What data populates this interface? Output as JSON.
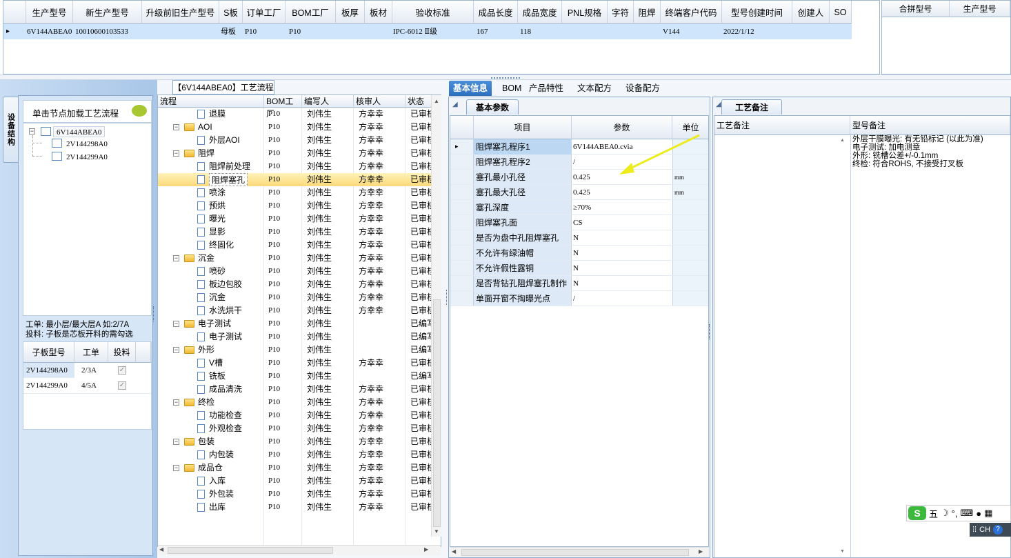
{
  "top_grid": {
    "headers": [
      "生产型号",
      "新生产型号",
      "升级前旧生产型号",
      "S板",
      "订单工厂",
      "BOM工厂",
      "板厚",
      "板材",
      "验收标准",
      "成品长度",
      "成品宽度",
      "PNL规格",
      "字符",
      "阻焊",
      "终端客户代码",
      "型号创建时间",
      "创建人",
      "SO"
    ],
    "row": {
      "marker": "▸",
      "生产型号": "6V144ABEA0",
      "新生产型号": "10010600103533",
      "升级前旧生产型号": "",
      "S板": "母板",
      "订单工厂": "P10",
      "BOM工厂": "P10",
      "板厚": "",
      "板材": "",
      "验收标准": "IPC-6012 Ⅱ级",
      "成品长度": "167",
      "成品宽度": "118",
      "PNL规格": "",
      "字符": "",
      "阻焊": "",
      "终端客户代码": "V144",
      "型号创建时间": "2022/1/12",
      "创建人": "",
      "SO": ""
    }
  },
  "merge_grid": {
    "headers": [
      "合拼型号",
      "生产型号"
    ]
  },
  "left_panel": {
    "vertical_tab": "设备结构",
    "load_hint": "单击节点加载工艺流程",
    "tree": {
      "root": "6V144ABEA0",
      "children": [
        "2V144298A0",
        "2V144299A0"
      ]
    },
    "work_order_note_line1": "工单: 最小层/最大层A 如:2/7A",
    "work_order_note_line2": "投料: 子板是芯板开料的需勾选",
    "sub_grid": {
      "headers": [
        "子板型号",
        "工单",
        "投料"
      ],
      "rows": [
        {
          "model": "2V144298A0",
          "order": "2/3A",
          "feed": true
        },
        {
          "model": "2V144299A0",
          "order": "4/5A",
          "feed": true
        }
      ]
    }
  },
  "process": {
    "title": "【6V144ABEA0】工艺流程",
    "headers": [
      "流程",
      "BOM工厂",
      "编写人",
      "核审人",
      "状态"
    ],
    "rows": [
      {
        "name": "退膜",
        "level": 2,
        "type": "file",
        "factory": "P10",
        "writer": "刘伟生",
        "reviewer": "方幸幸",
        "status": "已审核"
      },
      {
        "name": "AOI",
        "level": 1,
        "type": "folder",
        "factory": "P10",
        "writer": "刘伟生",
        "reviewer": "方幸幸",
        "status": "已审核"
      },
      {
        "name": "外层AOI",
        "level": 2,
        "type": "file",
        "factory": "P10",
        "writer": "刘伟生",
        "reviewer": "方幸幸",
        "status": "已审核"
      },
      {
        "name": "阻焊",
        "level": 1,
        "type": "folder",
        "factory": "P10",
        "writer": "刘伟生",
        "reviewer": "方幸幸",
        "status": "已审核"
      },
      {
        "name": "阻焊前处理",
        "level": 2,
        "type": "file",
        "factory": "P10",
        "writer": "刘伟生",
        "reviewer": "方幸幸",
        "status": "已审核"
      },
      {
        "name": "阻焊塞孔",
        "level": 2,
        "type": "file",
        "factory": "P10",
        "writer": "刘伟生",
        "reviewer": "方幸幸",
        "status": "已审核",
        "selected": true
      },
      {
        "name": "喷涂",
        "level": 2,
        "type": "file",
        "factory": "P10",
        "writer": "刘伟生",
        "reviewer": "方幸幸",
        "status": "已审核"
      },
      {
        "name": "预烘",
        "level": 2,
        "type": "file",
        "factory": "P10",
        "writer": "刘伟生",
        "reviewer": "方幸幸",
        "status": "已审核"
      },
      {
        "name": "曝光",
        "level": 2,
        "type": "file",
        "factory": "P10",
        "writer": "刘伟生",
        "reviewer": "方幸幸",
        "status": "已审核"
      },
      {
        "name": "显影",
        "level": 2,
        "type": "file",
        "factory": "P10",
        "writer": "刘伟生",
        "reviewer": "方幸幸",
        "status": "已审核"
      },
      {
        "name": "终固化",
        "level": 2,
        "type": "file",
        "factory": "P10",
        "writer": "刘伟生",
        "reviewer": "方幸幸",
        "status": "已审核"
      },
      {
        "name": "沉金",
        "level": 1,
        "type": "folder",
        "factory": "P10",
        "writer": "刘伟生",
        "reviewer": "方幸幸",
        "status": "已审核"
      },
      {
        "name": "喷砂",
        "level": 2,
        "type": "file",
        "factory": "P10",
        "writer": "刘伟生",
        "reviewer": "方幸幸",
        "status": "已审核"
      },
      {
        "name": "板边包胶",
        "level": 2,
        "type": "file",
        "factory": "P10",
        "writer": "刘伟生",
        "reviewer": "方幸幸",
        "status": "已审核"
      },
      {
        "name": "沉金",
        "level": 2,
        "type": "file",
        "factory": "P10",
        "writer": "刘伟生",
        "reviewer": "方幸幸",
        "status": "已审核"
      },
      {
        "name": "水洗烘干",
        "level": 2,
        "type": "file",
        "factory": "P10",
        "writer": "刘伟生",
        "reviewer": "方幸幸",
        "status": "已审核"
      },
      {
        "name": "电子测试",
        "level": 1,
        "type": "folder",
        "factory": "P10",
        "writer": "刘伟生",
        "reviewer": "",
        "status": "已编写"
      },
      {
        "name": "电子测试",
        "level": 2,
        "type": "file",
        "factory": "P10",
        "writer": "刘伟生",
        "reviewer": "",
        "status": "已编写"
      },
      {
        "name": "外形",
        "level": 1,
        "type": "folder",
        "factory": "P10",
        "writer": "刘伟生",
        "reviewer": "",
        "status": "已编写"
      },
      {
        "name": "V槽",
        "level": 2,
        "type": "file",
        "factory": "P10",
        "writer": "刘伟生",
        "reviewer": "方幸幸",
        "status": "已审核"
      },
      {
        "name": "铣板",
        "level": 2,
        "type": "file",
        "factory": "P10",
        "writer": "刘伟生",
        "reviewer": "",
        "status": "已编写"
      },
      {
        "name": "成品清洗",
        "level": 2,
        "type": "file",
        "factory": "P10",
        "writer": "刘伟生",
        "reviewer": "方幸幸",
        "status": "已审核"
      },
      {
        "name": "终检",
        "level": 1,
        "type": "folder",
        "factory": "P10",
        "writer": "刘伟生",
        "reviewer": "方幸幸",
        "status": "已审核"
      },
      {
        "name": "功能检查",
        "level": 2,
        "type": "file",
        "factory": "P10",
        "writer": "刘伟生",
        "reviewer": "方幸幸",
        "status": "已审核"
      },
      {
        "name": "外观检查",
        "level": 2,
        "type": "file",
        "factory": "P10",
        "writer": "刘伟生",
        "reviewer": "方幸幸",
        "status": "已审核"
      },
      {
        "name": "包装",
        "level": 1,
        "type": "folder",
        "factory": "P10",
        "writer": "刘伟生",
        "reviewer": "方幸幸",
        "status": "已审核"
      },
      {
        "name": "内包装",
        "level": 2,
        "type": "file",
        "factory": "P10",
        "writer": "刘伟生",
        "reviewer": "方幸幸",
        "status": "已审核"
      },
      {
        "name": "成品仓",
        "level": 1,
        "type": "folder",
        "factory": "P10",
        "writer": "刘伟生",
        "reviewer": "方幸幸",
        "status": "已审核"
      },
      {
        "name": "入库",
        "level": 2,
        "type": "file",
        "factory": "P10",
        "writer": "刘伟生",
        "reviewer": "方幸幸",
        "status": "已审核"
      },
      {
        "name": "外包装",
        "level": 2,
        "type": "file",
        "factory": "P10",
        "writer": "刘伟生",
        "reviewer": "方幸幸",
        "status": "已审核"
      },
      {
        "name": "出库",
        "level": 2,
        "type": "file",
        "factory": "P10",
        "writer": "刘伟生",
        "reviewer": "方幸幸",
        "status": "已审核"
      }
    ]
  },
  "right_tabs": [
    "基本信息",
    "BOM",
    "产品特性",
    "文本配方",
    "设备配方"
  ],
  "basic_params": {
    "tab": "基本参数",
    "headers": [
      "项目",
      "参数",
      "单位"
    ],
    "rows": [
      {
        "item": "阻焊塞孔程序1",
        "value": "6V144ABEA0.cvia",
        "unit": ""
      },
      {
        "item": "阻焊塞孔程序2",
        "value": "/",
        "unit": ""
      },
      {
        "item": "塞孔最小孔径",
        "value": "0.425",
        "unit": "mm"
      },
      {
        "item": "塞孔最大孔径",
        "value": "0.425",
        "unit": "mm"
      },
      {
        "item": "塞孔深度",
        "value": "≥70%",
        "unit": ""
      },
      {
        "item": "阻焊塞孔面",
        "value": "CS",
        "unit": ""
      },
      {
        "item": "是否为盘中孔阻焊塞孔",
        "value": "N",
        "unit": ""
      },
      {
        "item": "不允许有绿油帽",
        "value": "N",
        "unit": ""
      },
      {
        "item": "不允许假性露铜",
        "value": "N",
        "unit": ""
      },
      {
        "item": "是否背钻孔阻焊塞孔制作",
        "value": "N",
        "unit": ""
      },
      {
        "item": "单面开窗不掏曝光点",
        "value": "/",
        "unit": ""
      }
    ]
  },
  "process_notes": {
    "tab": "工艺备注",
    "headers": [
      "工艺备注",
      "型号备注"
    ],
    "model_note_lines": [
      "外层干膜曝光: 有无铅标记 (以此为准)",
      "电子测试: 加电测章",
      "外形: 铣槽公差+/-0.1mm",
      "终检: 符合ROHS, 不接受打叉板"
    ]
  },
  "ime": {
    "mode": "五",
    "lang": "CH"
  },
  "colors": {
    "selection_row": "#cfe5fb",
    "active_tab": "#2c6fbf",
    "tree_selected": "#fbd97a",
    "arrow": "#f2f200"
  }
}
